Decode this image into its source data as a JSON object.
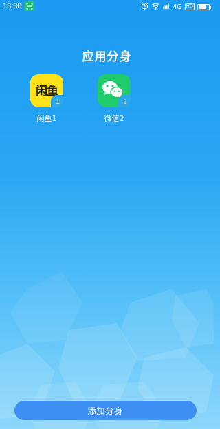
{
  "status_bar": {
    "time": "18:30",
    "network": "4G",
    "hd": "HD",
    "battery_level": 0.7,
    "icons": [
      "scan-icon",
      "alarm-icon",
      "wifi-icon",
      "signal-icon",
      "battery-icon"
    ]
  },
  "page": {
    "title": "应用分身"
  },
  "apps": [
    {
      "label": "闲鱼1",
      "badge": "1",
      "icon": "xianyu-app-icon",
      "icon_text": "闲鱼",
      "color": "#ffe21a"
    },
    {
      "label": "微信2",
      "badge": "2",
      "icon": "wechat-app-icon",
      "color": "#1fcb6a"
    }
  ],
  "footer": {
    "add_button_label": "添加分身",
    "button_color": "#3d8ff3"
  },
  "colors": {
    "background_top": "#1a9af1",
    "background_bottom": "#8dd7fb",
    "badge": "#2aa8ea"
  }
}
